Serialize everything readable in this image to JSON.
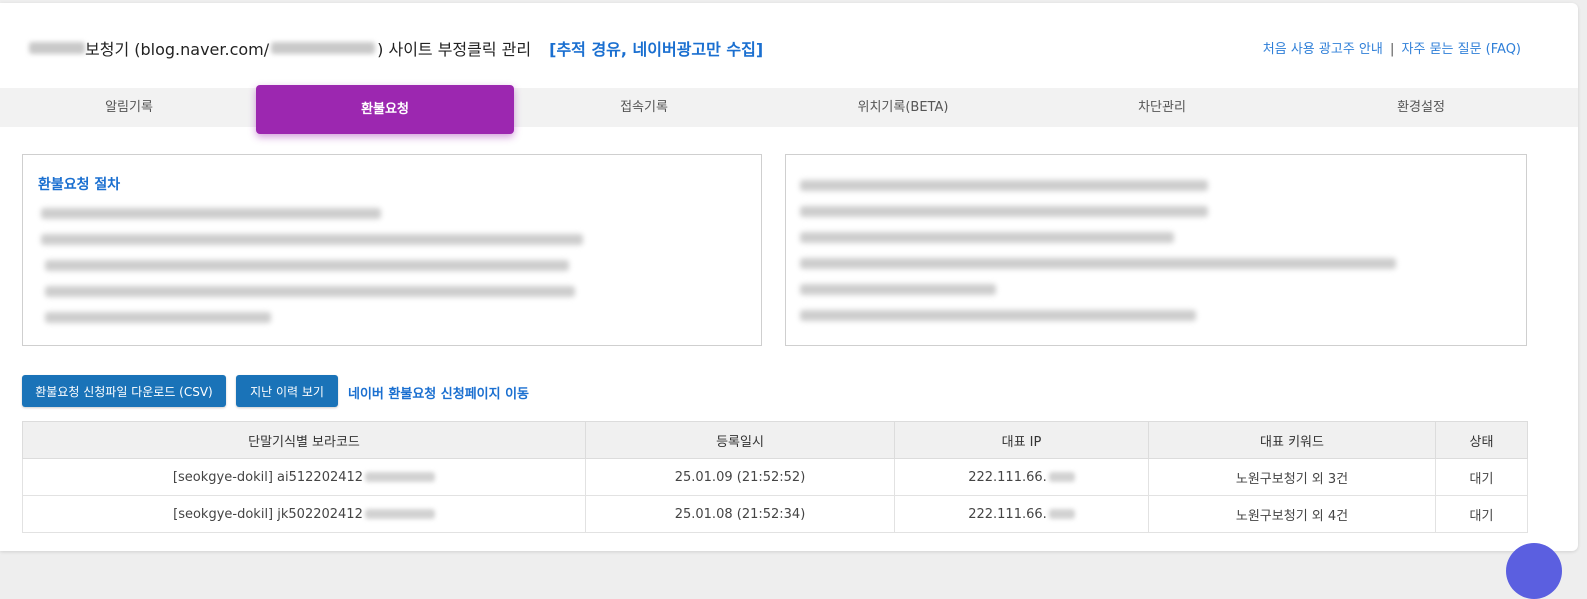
{
  "header": {
    "title_main": "보청기 (blog.naver.com/",
    "title_end": ") 사이트 부정클릭 관리",
    "title_tag": "[추적 경유, 네이버광고만 수집]",
    "help_link_1": "처음 사용 광고주 안내",
    "help_sep": "|",
    "help_link_2": "자주 묻는 질문 (FAQ)"
  },
  "tabs": [
    {
      "label": "알림기록"
    },
    {
      "label": "환불요청"
    },
    {
      "label": "접속기록"
    },
    {
      "label": "위치기록(BETA)"
    },
    {
      "label": "차단관리"
    },
    {
      "label": "환경설정"
    }
  ],
  "info_box": {
    "title": "환불요청 절차"
  },
  "actions": {
    "download_button": "환불요청 신청파일 다운로드 (CSV)",
    "history_button": "지난 이력 보기",
    "naver_link": "네이버 환불요청 신청페이지 이동"
  },
  "table": {
    "headers": [
      "단말기식별 보라코드",
      "등록일시",
      "대표 IP",
      "대표 키워드",
      "상태"
    ],
    "rows": [
      {
        "code": "[seokgye-dokil] ai512202412",
        "date": "25.01.09 (21:52:52)",
        "ip": "222.111.66.",
        "keyword": "노원구보청기 외 3건",
        "status": "대기"
      },
      {
        "code": "[seokgye-dokil] jk502202412",
        "date": "25.01.08 (21:52:34)",
        "ip": "222.111.66.",
        "keyword": "노원구보청기 외 4건",
        "status": "대기"
      }
    ]
  },
  "colors": {
    "accent_tab": "#9c27b0",
    "button": "#1a73b8",
    "link": "#1a6fd0"
  }
}
